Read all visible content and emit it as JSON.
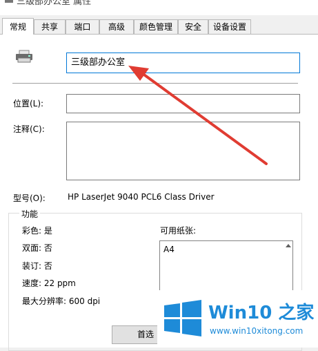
{
  "window": {
    "title": "三级部办公室 属性"
  },
  "tabs": [
    {
      "label": "常规"
    },
    {
      "label": "共享"
    },
    {
      "label": "端口"
    },
    {
      "label": "高级"
    },
    {
      "label": "颜色管理"
    },
    {
      "label": "安全"
    },
    {
      "label": "设备设置"
    }
  ],
  "general": {
    "printer_name": "三级部办公室",
    "location_label": "位置(L):",
    "location_value": "",
    "comment_label": "注释(C):",
    "comment_value": "",
    "model_label": "型号(O):",
    "model_value": "HP LaserJet 9040 PCL6 Class Driver"
  },
  "features": {
    "legend": "功能",
    "color": "彩色: 是",
    "duplex": "双面: 否",
    "staple": "装订: 否",
    "speed": "速度: 22 ppm",
    "max_resolution": "最大分辨率: 600 dpi",
    "paper_label": "可用纸张:",
    "paper_items": [
      "A4"
    ]
  },
  "buttons": {
    "preferences": "首选"
  },
  "watermark": {
    "title": "Win10 之家",
    "url": "www.win10xitong.com"
  },
  "icons": [
    "printer-icon",
    "scroll-up-icon",
    "windows-logo-icon"
  ],
  "colors": {
    "focus_border": "#0078d7",
    "arrow": "#e03c32",
    "watermark": "#1e8bd8"
  }
}
